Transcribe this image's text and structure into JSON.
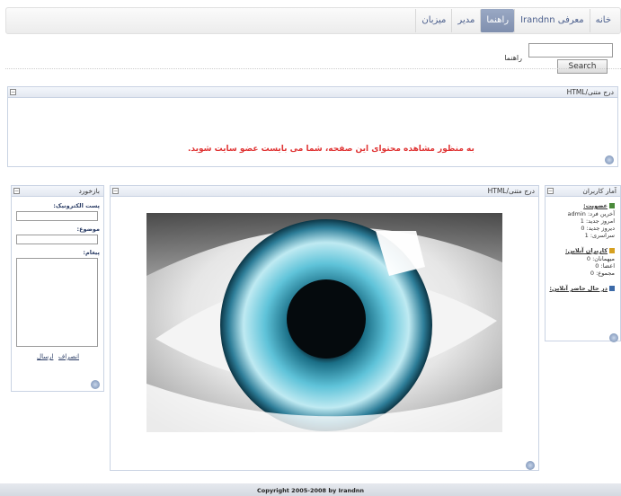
{
  "nav": {
    "items": [
      {
        "label": "خانه",
        "active": false
      },
      {
        "label": "معرفی Irandnn",
        "active": false
      },
      {
        "label": "راهنما",
        "active": true
      },
      {
        "label": "مدیر",
        "active": false
      },
      {
        "label": "میزبان",
        "active": false
      }
    ]
  },
  "search": {
    "button_label": "Search",
    "value": ""
  },
  "breadcrumb": "راهنما",
  "top_panel": {
    "title": "درج متنی/HTML",
    "warning": "به منظور مشاهده محتوای این صفحه، شما می بایست عضو سایت شوید."
  },
  "stats_panel": {
    "title": "آمار کاربران",
    "members_heading": "عضویت:",
    "latest_label": "آخرین فرد: admin",
    "today_label": "امروز جدید: 1",
    "yesterday_label": "دیروز جدید: 0",
    "total_label": "سراسری: 1",
    "online_heading": "کاربران آنلاین:",
    "visitors_label": "میهمانان: 0",
    "members_label": "اعضا: 0",
    "sum_label": "مجموع: 0",
    "online_link": "در حال حاضر آنلاین:"
  },
  "center_panel": {
    "title": "درج متنی/HTML"
  },
  "feedback_panel": {
    "title": "بازخورد",
    "email_label": "پست الکترونیک:",
    "subject_label": "موضوع:",
    "message_label": "پیغام:",
    "cancel_link": "انصراف",
    "send_link": "ارسال"
  },
  "footer": {
    "copyright": "Copyright 2005-2008 by Irandnn"
  },
  "colors": {
    "accent": "#7f8fae",
    "warning": "#e03535",
    "panel_border": "#c9d3e3"
  }
}
